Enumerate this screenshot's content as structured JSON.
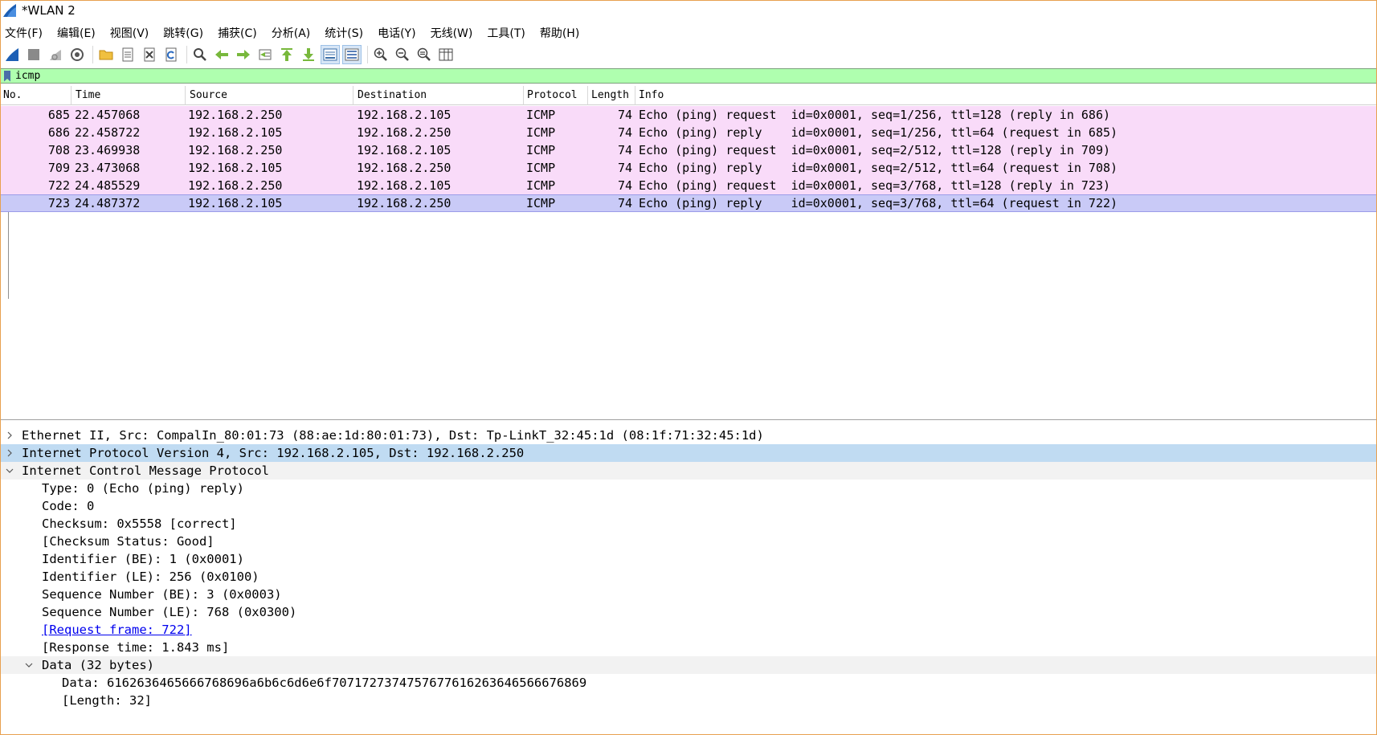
{
  "window": {
    "title": "*WLAN 2"
  },
  "menu": [
    "文件(F)",
    "编辑(E)",
    "视图(V)",
    "跳转(G)",
    "捕获(C)",
    "分析(A)",
    "统计(S)",
    "电话(Y)",
    "无线(W)",
    "工具(T)",
    "帮助(H)"
  ],
  "toolbar": {
    "buttons": [
      "shark-fin-start-icon",
      "stop-square-icon",
      "restart-fin-icon",
      "options-gear-icon",
      "open-folder-icon",
      "save-file-icon",
      "close-file-icon",
      "reload-icon",
      "find-magnifier-icon",
      "go-back-arrow-icon",
      "go-forward-arrow-icon",
      "goto-packet-icon",
      "first-packet-icon",
      "last-packet-icon",
      "autoscroll-icon",
      "colorize-icon",
      "zoom-in-icon",
      "zoom-out-icon",
      "zoom-normal-icon",
      "resize-columns-icon"
    ]
  },
  "filter": {
    "value": "icmp"
  },
  "packet_list": {
    "columns": [
      "No.",
      "Time",
      "Source",
      "Destination",
      "Protocol",
      "Length",
      "Info"
    ],
    "rows": [
      {
        "no": "685",
        "time": "22.457068",
        "source": "192.168.2.250",
        "destination": "192.168.2.105",
        "protocol": "ICMP",
        "length": "74",
        "info": "Echo (ping) request  id=0x0001, seq=1/256, ttl=128 (reply in 686)"
      },
      {
        "no": "686",
        "time": "22.458722",
        "source": "192.168.2.105",
        "destination": "192.168.2.250",
        "protocol": "ICMP",
        "length": "74",
        "info": "Echo (ping) reply    id=0x0001, seq=1/256, ttl=64 (request in 685)"
      },
      {
        "no": "708",
        "time": "23.469938",
        "source": "192.168.2.250",
        "destination": "192.168.2.105",
        "protocol": "ICMP",
        "length": "74",
        "info": "Echo (ping) request  id=0x0001, seq=2/512, ttl=128 (reply in 709)"
      },
      {
        "no": "709",
        "time": "23.473068",
        "source": "192.168.2.105",
        "destination": "192.168.2.250",
        "protocol": "ICMP",
        "length": "74",
        "info": "Echo (ping) reply    id=0x0001, seq=2/512, ttl=64 (request in 708)"
      },
      {
        "no": "722",
        "time": "24.485529",
        "source": "192.168.2.250",
        "destination": "192.168.2.105",
        "protocol": "ICMP",
        "length": "74",
        "info": "Echo (ping) request  id=0x0001, seq=3/768, ttl=128 (reply in 723)"
      },
      {
        "no": "723",
        "time": "24.487372",
        "source": "192.168.2.105",
        "destination": "192.168.2.250",
        "protocol": "ICMP",
        "length": "74",
        "info": "Echo (ping) reply    id=0x0001, seq=3/768, ttl=64 (request in 722)"
      }
    ],
    "selected_row": "723"
  },
  "details": {
    "ethernet": "Ethernet II, Src: CompalIn_80:01:73 (88:ae:1d:80:01:73), Dst: Tp-LinkT_32:45:1d (08:1f:71:32:45:1d)",
    "ipv4": "Internet Protocol Version 4, Src: 192.168.2.105, Dst: 192.168.2.250",
    "icmp": "Internet Control Message Protocol",
    "icmp_fields": [
      "Type: 0 (Echo (ping) reply)",
      "Code: 0",
      "Checksum: 0x5558 [correct]",
      "[Checksum Status: Good]",
      "Identifier (BE): 1 (0x0001)",
      "Identifier (LE): 256 (0x0100)",
      "Sequence Number (BE): 3 (0x0003)",
      "Sequence Number (LE): 768 (0x0300)"
    ],
    "request_frame": "[Request frame: 722]",
    "response_time": "[Response time: 1.843 ms]",
    "data_header": "Data (32 bytes)",
    "data_value": "Data: 6162636465666768696a6b6c6d6e6f7071727374757677616263646566676869",
    "data_length": "[Length: 32]"
  },
  "colors": {
    "row_bg": "#f9dbf9",
    "selected_row_bg": "#c9caf7",
    "filter_bg": "#afffaf",
    "detail_highlight": "#c0dbf2",
    "link": "#0000ee"
  }
}
